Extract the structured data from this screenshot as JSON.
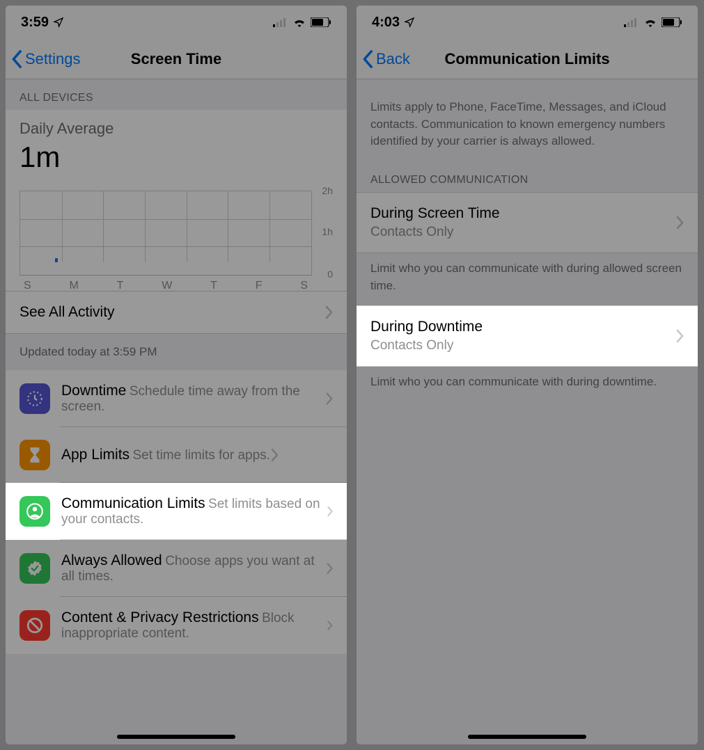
{
  "left": {
    "status": {
      "time": "3:59"
    },
    "nav": {
      "back": "Settings",
      "title": "Screen Time"
    },
    "header1": "ALL DEVICES",
    "daily": {
      "label": "Daily Average",
      "value": "1m"
    },
    "chart": {
      "ylabels": [
        "2h",
        "1h",
        "0"
      ],
      "days": [
        "S",
        "M",
        "T",
        "W",
        "T",
        "F",
        "S"
      ]
    },
    "seeAll": "See All Activity",
    "updated": "Updated today at 3:59 PM",
    "menu": [
      {
        "title": "Downtime",
        "sub": "Schedule time away from the screen.",
        "icon": "downtime",
        "color": "#5856d6"
      },
      {
        "title": "App Limits",
        "sub": "Set time limits for apps.",
        "icon": "hourglass",
        "color": "#ff9500"
      },
      {
        "title": "Communication Limits",
        "sub": "Set limits based on your contacts.",
        "icon": "person",
        "color": "#34c759"
      },
      {
        "title": "Always Allowed",
        "sub": "Choose apps you want at all times.",
        "icon": "check",
        "color": "#34c759"
      },
      {
        "title": "Content & Privacy Restrictions",
        "sub": "Block inappropriate content.",
        "icon": "no",
        "color": "#ff3b30"
      }
    ]
  },
  "right": {
    "status": {
      "time": "4:03"
    },
    "nav": {
      "back": "Back",
      "title": "Communication Limits"
    },
    "intro": "Limits apply to Phone, FaceTime, Messages, and iCloud contacts. Communication to known emergency numbers identified by your carrier is always allowed.",
    "header2": "ALLOWED COMMUNICATION",
    "rows": [
      {
        "title": "During Screen Time",
        "sub": "Contacts Only",
        "note": "Limit who you can communicate with during allowed screen time."
      },
      {
        "title": "During Downtime",
        "sub": "Contacts Only",
        "note": "Limit who you can communicate with during downtime."
      }
    ]
  }
}
